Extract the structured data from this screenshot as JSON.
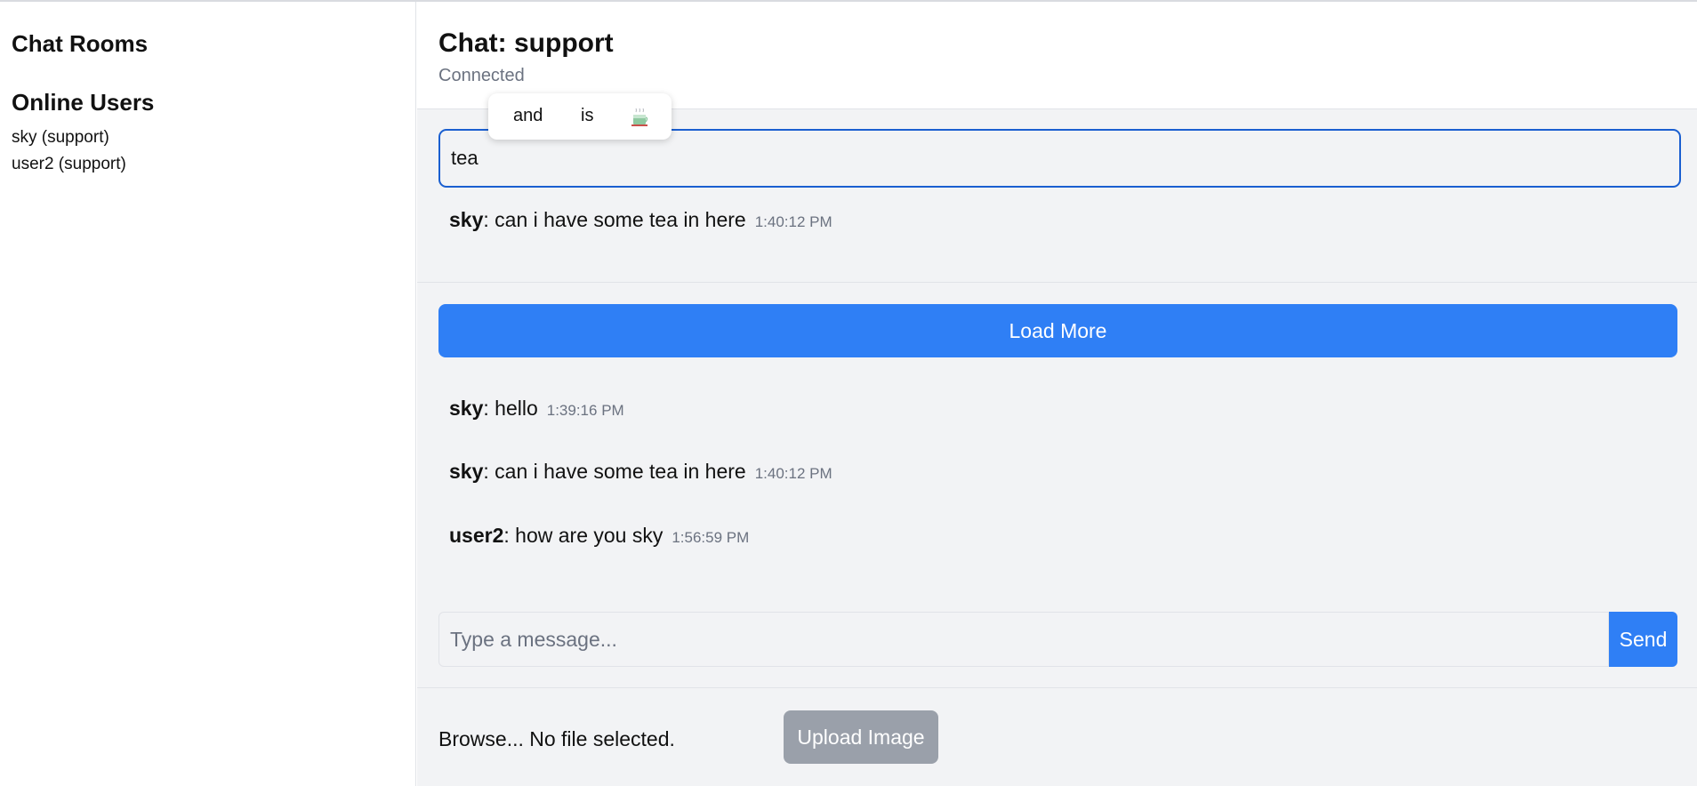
{
  "sidebar": {
    "rooms_title": "Chat Rooms",
    "users_title": "Online Users",
    "users": [
      "sky (support)",
      "user2 (support)"
    ]
  },
  "header": {
    "title": "Chat: support",
    "status": "Connected"
  },
  "suggestions": {
    "items": [
      "and",
      "is"
    ],
    "emoji_icon": "teacup-icon"
  },
  "search": {
    "value": "tea"
  },
  "search_result": {
    "user": "sky",
    "text": ": can i have some tea in here",
    "time": "1:40:12 PM"
  },
  "load_more_label": "Load More",
  "messages": [
    {
      "user": "sky",
      "text": ": hello",
      "time": "1:39:16 PM"
    },
    {
      "user": "sky",
      "text": ": can i have some tea in here",
      "time": "1:40:12 PM"
    },
    {
      "user": "user2",
      "text": ": how are you sky",
      "time": "1:56:59 PM"
    }
  ],
  "composer": {
    "placeholder": "Type a message...",
    "send_label": "Send"
  },
  "upload": {
    "file_text": "Browse... No file selected.",
    "button_label": "Upload Image"
  },
  "colors": {
    "accent": "#2f7ff5",
    "focus_border": "#1a5fd0",
    "disabled": "#9aa0aa",
    "muted_text": "#6b7280",
    "panel_bg": "#f2f3f5"
  }
}
